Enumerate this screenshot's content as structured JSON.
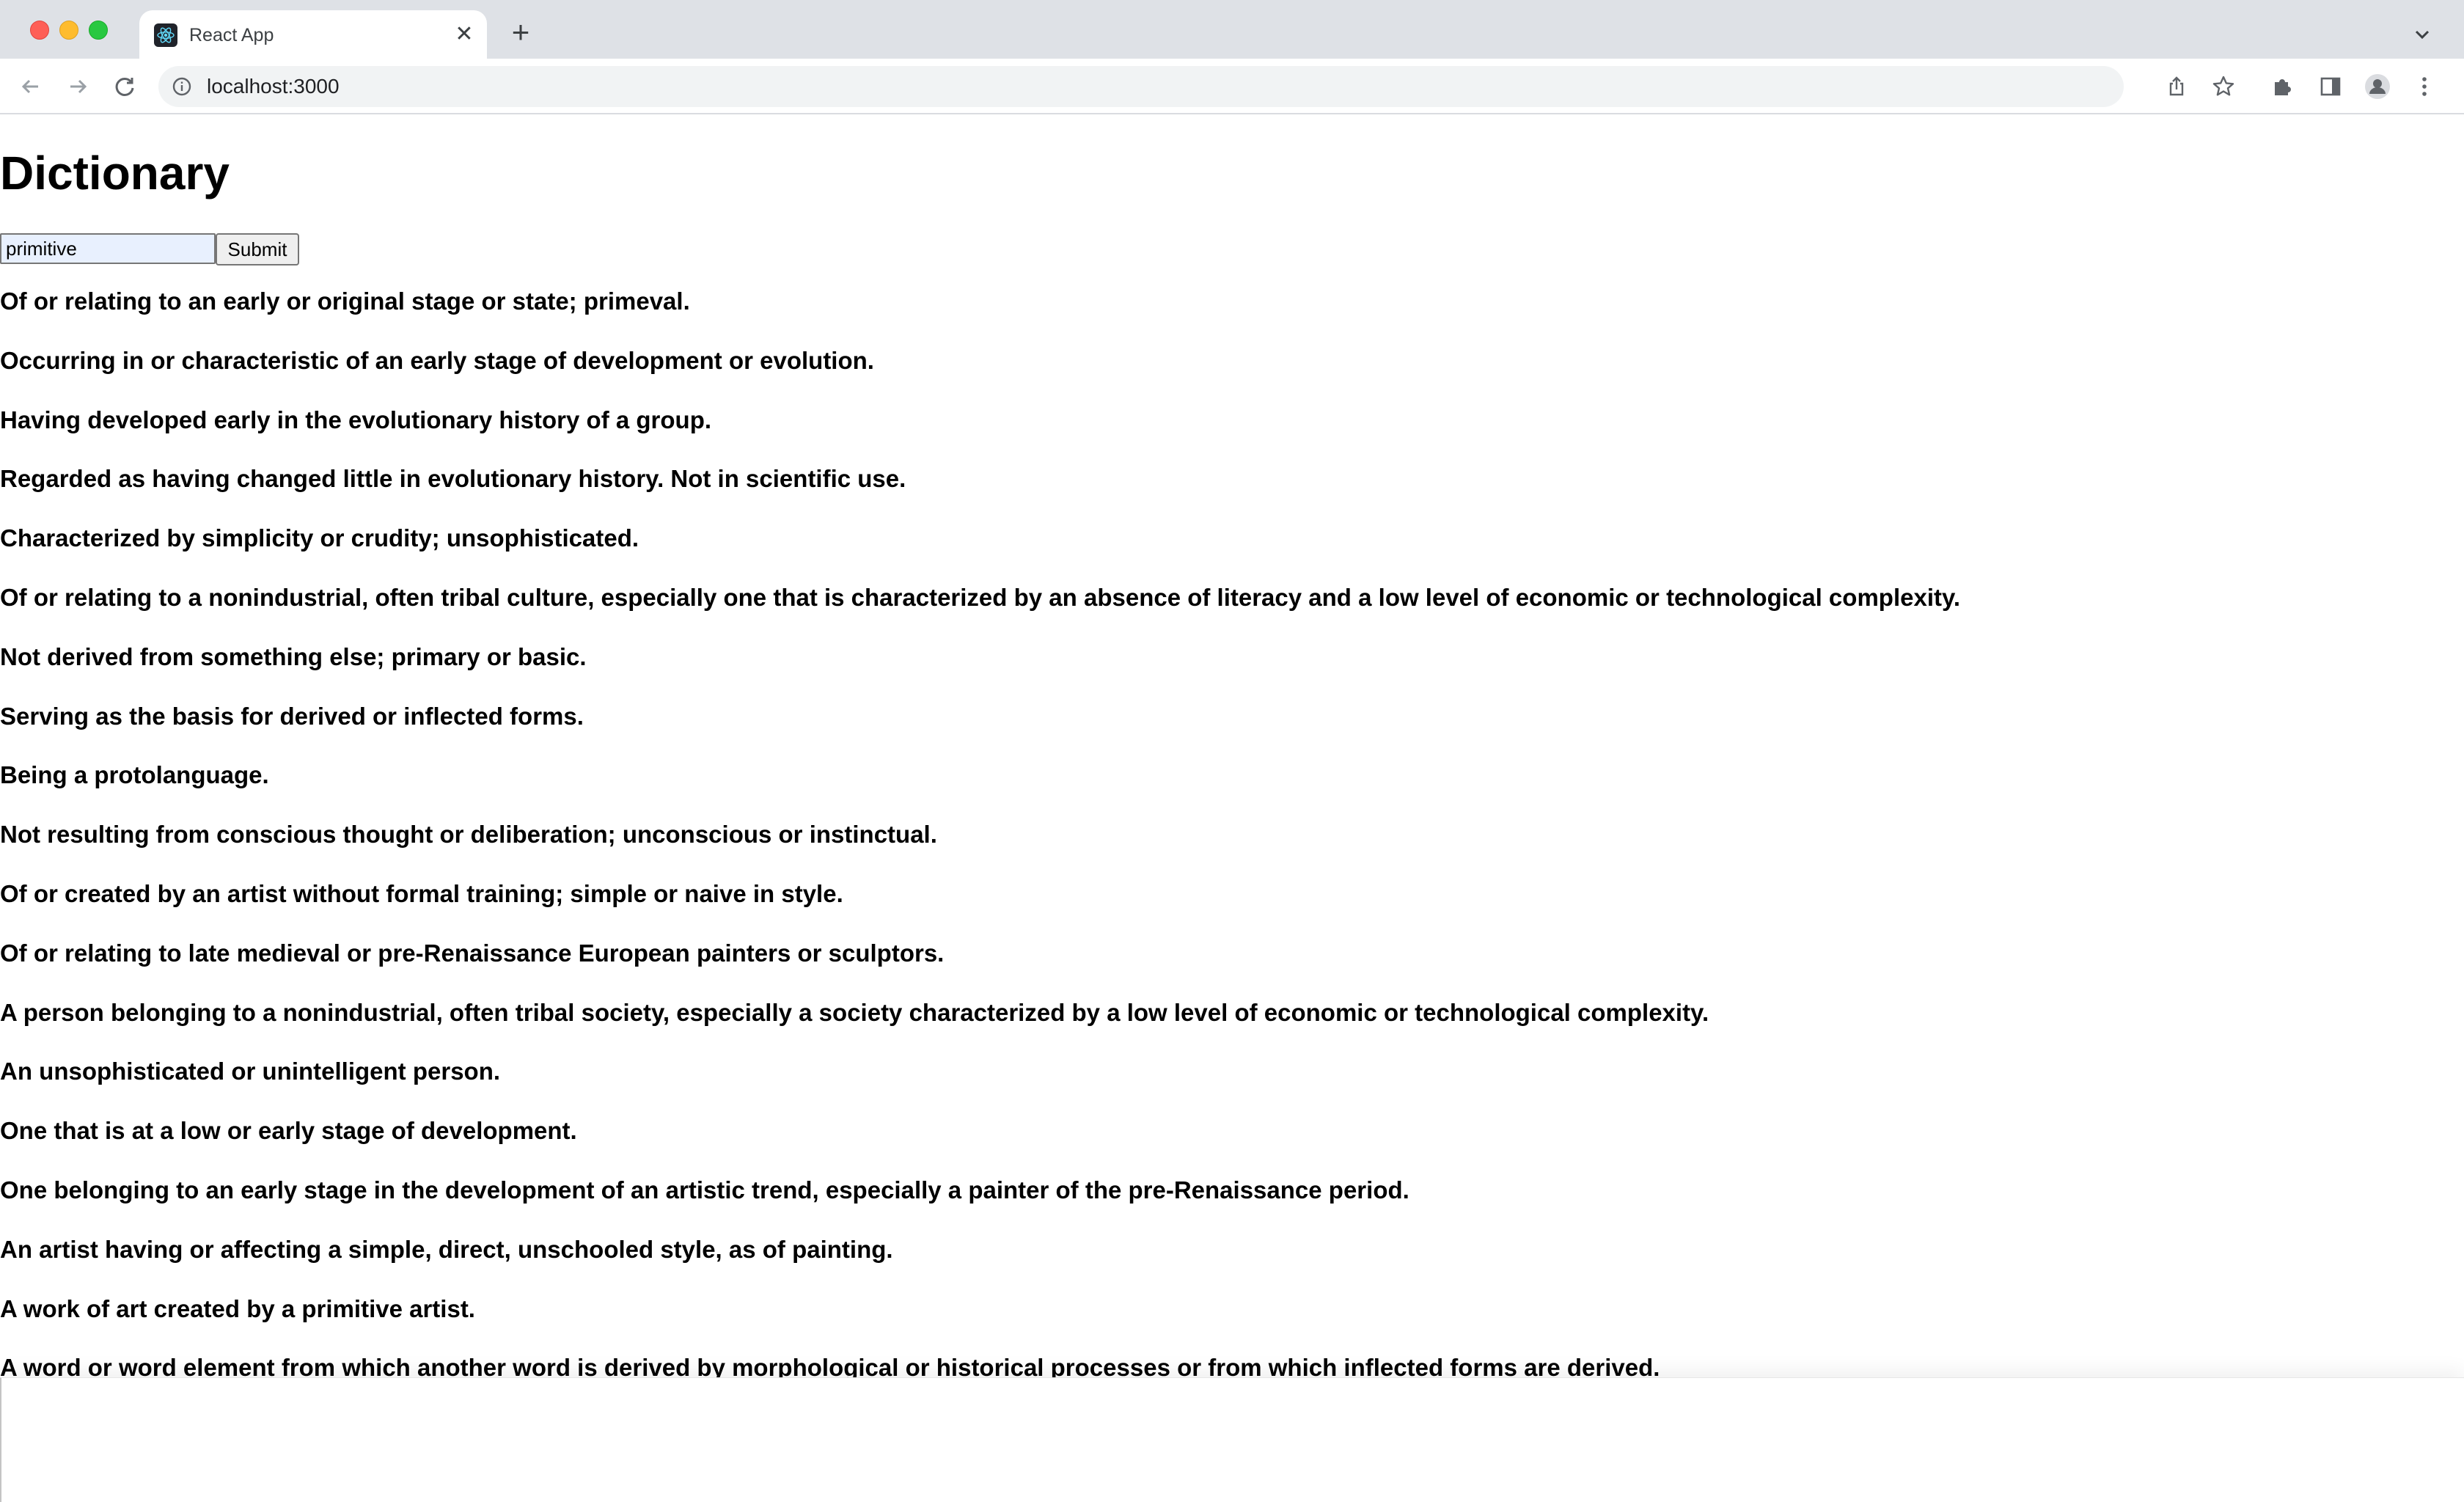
{
  "browser": {
    "tab_title": "React App",
    "url": "localhost:3000",
    "new_tab_symbol": "+",
    "close_symbol": "✕",
    "icons": [
      "react-logo-icon",
      "back-arrow-icon",
      "forward-arrow-icon",
      "reload-icon",
      "info-icon",
      "share-icon",
      "star-icon",
      "puzzle-icon",
      "sidebar-icon",
      "profile-icon",
      "kebab-menu-icon",
      "tab-list-chevron-icon"
    ]
  },
  "page": {
    "title": "Dictionary",
    "input_value": "primitive",
    "submit_label": "Submit",
    "definitions": [
      "Of or relating to an early or original stage or state; primeval.",
      "Occurring in or characteristic of an early stage of development or evolution.",
      "Having developed early in the evolutionary history of a group.",
      "Regarded as having changed little in evolutionary history. Not in scientific use.",
      "Characterized by simplicity or crudity; unsophisticated.",
      "Of or relating to a nonindustrial, often tribal culture, especially one that is characterized by an absence of literacy and a low level of economic or technological complexity.",
      "Not derived from something else; primary or basic.",
      "Serving as the basis for derived or inflected forms.",
      "Being a protolanguage.",
      "Not resulting from conscious thought or deliberation; unconscious or instinctual.",
      "Of or created by an artist without formal training; simple or naive in style.",
      "Of or relating to late medieval or pre-Renaissance European painters or sculptors.",
      "A person belonging to a nonindustrial, often tribal society, especially a society characterized by a low level of economic or technological complexity.",
      "An unsophisticated or unintelligent person.",
      "One that is at a low or early stage of development.",
      "One belonging to an early stage in the development of an artistic trend, especially a painter of the pre-Renaissance period.",
      "An artist having or affecting a simple, direct, unschooled style, as of painting.",
      "A work of art created by a primitive artist.",
      "A word or word element from which another word is derived by morphological or historical processes or from which inflected forms are derived."
    ]
  },
  "colors": {
    "tabstrip": "#dee1e6",
    "omnibox": "#f1f3f4",
    "autofill": "#e8f0fe",
    "traffic_red": "#fe5f57",
    "traffic_yellow": "#febc2e",
    "traffic_green": "#28c840"
  }
}
